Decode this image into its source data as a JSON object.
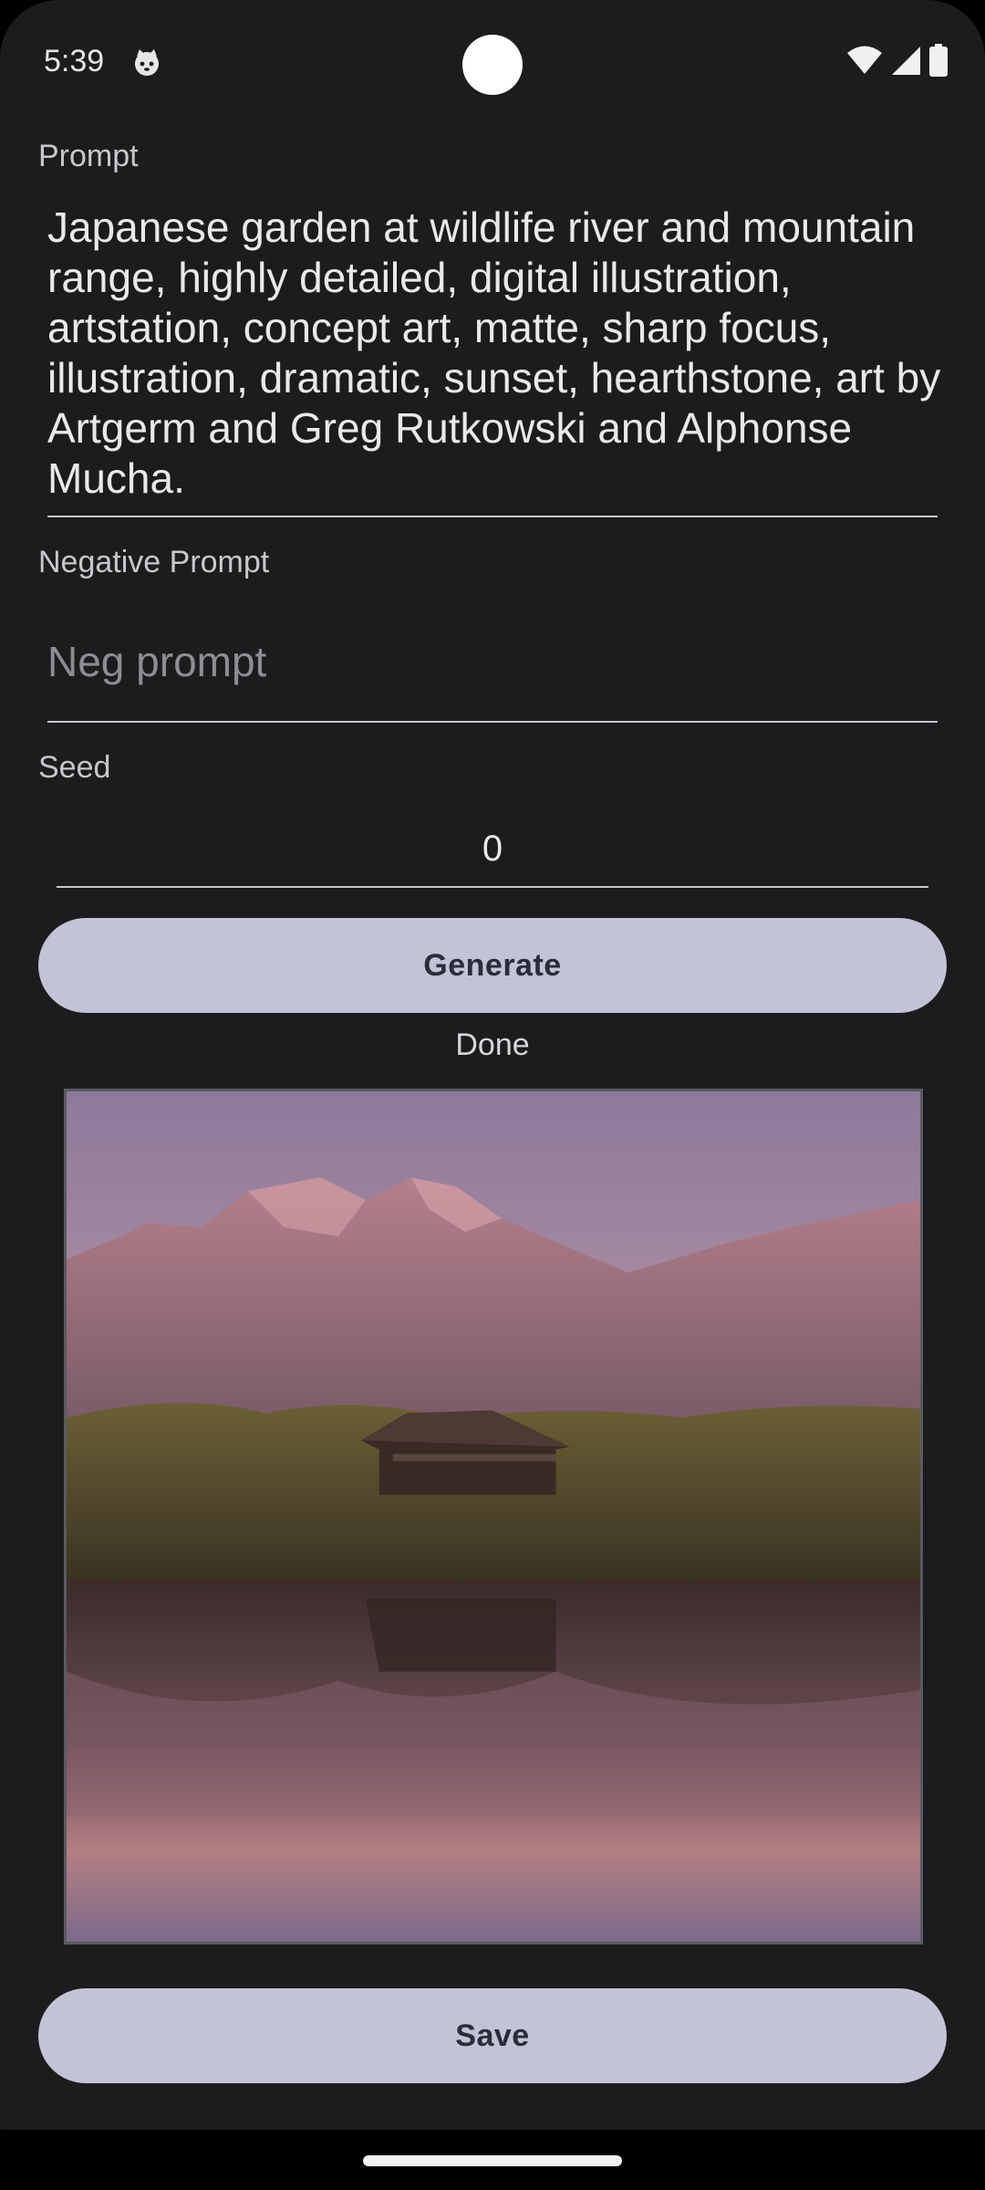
{
  "status_bar": {
    "time": "5:39",
    "notification_icon": "cat-face-icon",
    "icons": [
      "wifi-icon",
      "cellular-signal-icon",
      "battery-icon"
    ]
  },
  "form": {
    "prompt_label": "Prompt",
    "prompt_value": "Japanese garden at wildlife river and mountain range, highly detailed, digital illustration, artstation, concept art, matte, sharp focus, illustration, dramatic, sunset, hearthstone, art by Artgerm and Greg Rutkowski and Alphonse Mucha.",
    "negative_label": "Negative Prompt",
    "negative_value": "",
    "negative_placeholder": "Neg prompt",
    "seed_label": "Seed",
    "seed_value": "0"
  },
  "actions": {
    "generate_label": "Generate",
    "status_text": "Done",
    "save_label": "Save"
  },
  "colors": {
    "background": "#1c1c1e",
    "button": "#c2c4d6",
    "button_text": "#2b2d3a"
  }
}
